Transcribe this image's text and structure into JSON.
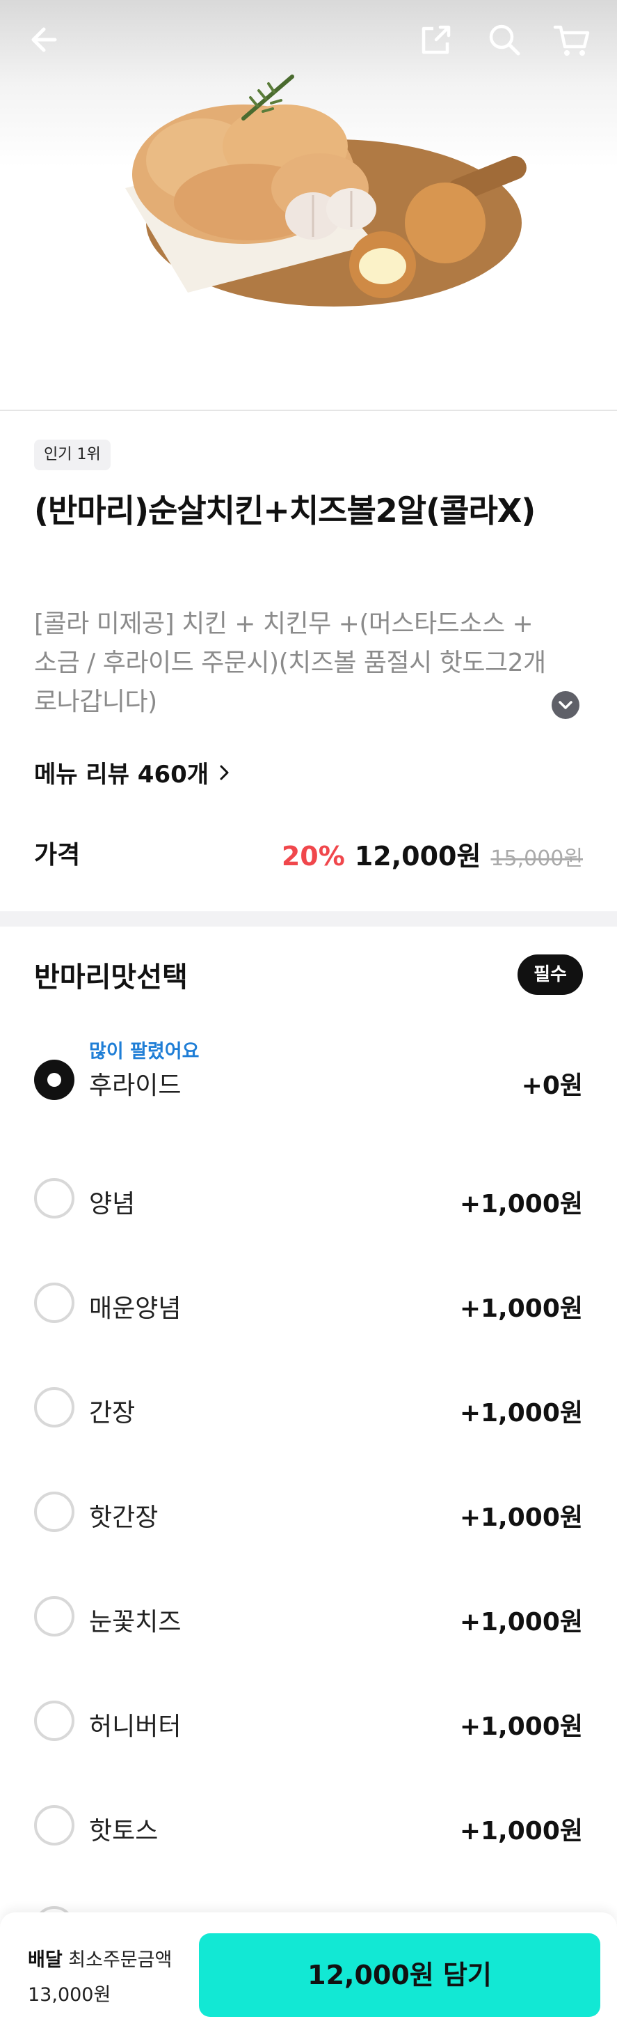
{
  "header": {
    "back_icon": "arrow-left-icon",
    "share_icon": "share-icon",
    "search_icon": "search-icon",
    "cart_icon": "cart-icon"
  },
  "product": {
    "rank_badge": "인기 1위",
    "title": "(반마리)순살치킨+치즈볼2알(콜라X)",
    "description": "[콜라 미제공] 치킨 + 치킨무 +(머스타드소스 + 소금 / 후라이드 주문시)(치즈볼 품절시 핫도그2개로나갑니다)",
    "review_link": "메뉴 리뷰 460개",
    "price_label": "가격",
    "discount": "20%",
    "price": "12,000원",
    "original_price": "15,000원"
  },
  "option_group": {
    "title": "반마리맛선택",
    "required_badge": "필수",
    "items": [
      {
        "tag": "많이 팔렸어요",
        "name": "후라이드",
        "price": "+0원",
        "selected": true
      },
      {
        "name": "양념",
        "price": "+1,000원",
        "selected": false
      },
      {
        "name": "매운양념",
        "price": "+1,000원",
        "selected": false
      },
      {
        "name": "간장",
        "price": "+1,000원",
        "selected": false
      },
      {
        "name": "핫간장",
        "price": "+1,000원",
        "selected": false
      },
      {
        "name": "눈꽃치즈",
        "price": "+1,000원",
        "selected": false
      },
      {
        "name": "허니버터",
        "price": "+1,000원",
        "selected": false
      },
      {
        "name": "핫토스",
        "price": "+1,000원",
        "selected": false
      }
    ]
  },
  "bottom_bar": {
    "delivery_label": "배달",
    "min_order_label": "최소주문금액",
    "min_order_amount": "13,000원",
    "cta_label": "12,000원 담기"
  },
  "colors": {
    "accent": "#12e8d4",
    "discount": "#f0474c",
    "tag": "#1f7ed6"
  }
}
